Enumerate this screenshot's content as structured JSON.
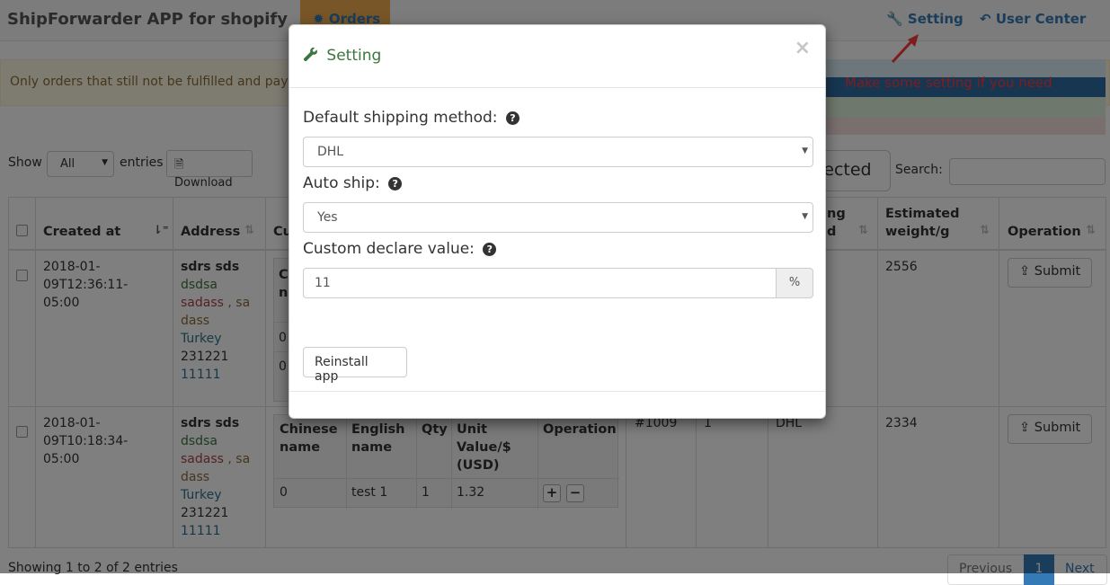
{
  "navbar": {
    "brand": "ShipForwarder APP for shopify",
    "orders_label": "Orders",
    "setting_label": "Setting",
    "user_center_label": "User Center"
  },
  "alert": {
    "text": "Only orders that still not be fulfilled and pay",
    "annotation": "Make some setting if you need"
  },
  "controls": {
    "show_label": "Show",
    "show_value": "All",
    "entries_label": "entries",
    "download_label": "Download",
    "selected_partial_label": "lected",
    "search_label": "Search:",
    "search_value": ""
  },
  "table": {
    "headers": {
      "created_at": "Created at",
      "address": "Address",
      "cu_partial": "Cu",
      "shipping_partial_1": "ng",
      "shipping_partial_2": "d",
      "weight_1": "Estimated",
      "weight_2": "weight/g",
      "operation": "Operation"
    },
    "rows": [
      {
        "created_at": [
          "2018-01-",
          "09T12:36:11-",
          "05:00"
        ],
        "address": {
          "name": "sdrs sds",
          "line1": "dsdsa",
          "line2a": "sadass",
          "line2b": " , sa",
          "line3": "dass",
          "country": "Turkey",
          "zip": "231221",
          "phone": "11111"
        },
        "sub_partial": {
          "h1": "C",
          "h2": "n",
          "v1": "0",
          "v2": "0"
        },
        "weight": "2556",
        "submit_label": "Submit"
      },
      {
        "created_at": [
          "2018-01-",
          "09T10:18:34-",
          "05:00"
        ],
        "address": {
          "name": "sdrs sds",
          "line1": "dsdsa",
          "line2a": "sadass",
          "line2b": " , sa",
          "line3": "dass",
          "country": "Turkey",
          "zip": "231221",
          "phone": "11111"
        },
        "subtable": {
          "headers": [
            [
              "Chinese",
              "name"
            ],
            [
              "English",
              "name"
            ],
            [
              "Qty"
            ],
            [
              "Unit",
              "Value/$",
              "(USD)"
            ],
            [
              "Operation"
            ]
          ],
          "row": [
            "0",
            "test 1",
            "1",
            "1.32"
          ]
        },
        "order_no": "#1009",
        "qty": "1",
        "shipping": "DHL",
        "weight": "2334",
        "submit_label": "Submit"
      }
    ]
  },
  "footer": {
    "info": "Showing 1 to 2 of 2 entries",
    "previous": "Previous",
    "page": "1",
    "next": "Next"
  },
  "modal": {
    "title": "Setting",
    "close": "×",
    "fields": {
      "shipping_method_label": "Default shipping method:",
      "shipping_method_value": "DHL",
      "auto_ship_label": "Auto ship:",
      "auto_ship_value": "Yes",
      "declare_label": "Custom declare value:",
      "declare_value": "11",
      "declare_unit": "%"
    },
    "help_glyph": "?",
    "reinstall_label": "Reinstall app"
  },
  "colors": {
    "title_green": "#3c763d",
    "link_blue": "#337ab7",
    "annotation_red": "#ff3b3b",
    "orders_tab": "#f0ad4e"
  }
}
